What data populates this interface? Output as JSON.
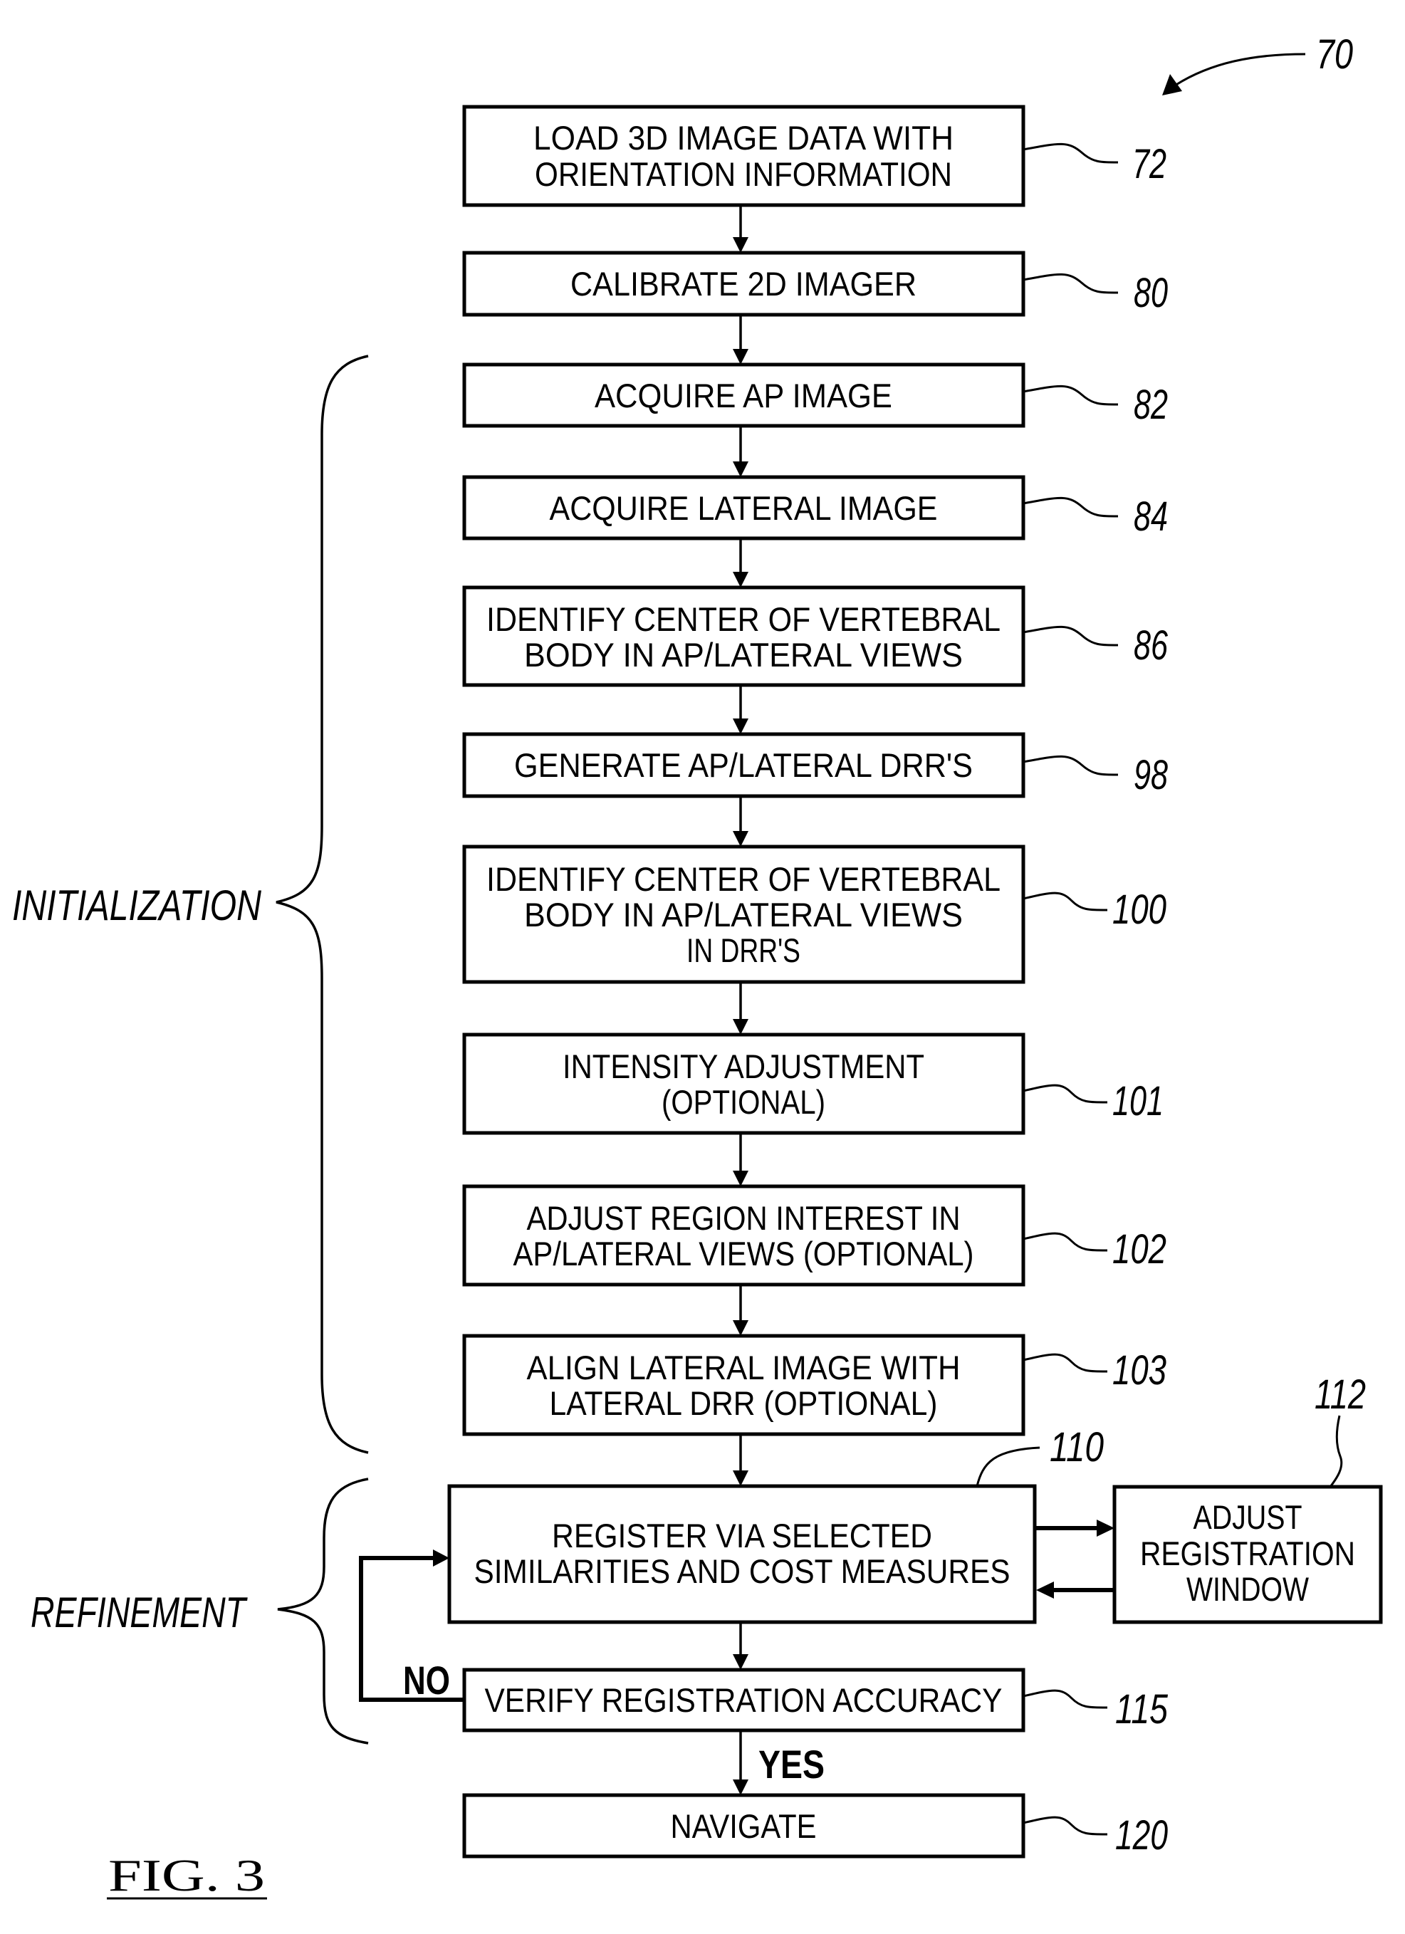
{
  "figure": {
    "label": "FIG.  3",
    "reference": "70"
  },
  "phases": {
    "initialization": "INITIALIZATION",
    "refinement": "REFINEMENT"
  },
  "decision": {
    "yes": "YES",
    "no": "NO"
  },
  "steps": {
    "load": {
      "ref": "72",
      "lines": [
        "LOAD  3D  IMAGE  DATA WITH",
        "ORIENTATION  INFORMATION"
      ]
    },
    "calibrate": {
      "ref": "80",
      "lines": [
        "CALIBRATE  2D  IMAGER"
      ]
    },
    "acquire_ap": {
      "ref": "82",
      "lines": [
        "ACQUIRE  AP  IMAGE"
      ]
    },
    "acquire_lateral": {
      "ref": "84",
      "lines": [
        "ACQUIRE  LATERAL  IMAGE"
      ]
    },
    "identify_center": {
      "ref": "86",
      "lines": [
        "IDENTIFY  CENTER  OF  VERTEBRAL",
        "BODY   IN  AP/LATERAL  VIEWS"
      ]
    },
    "generate_drr": {
      "ref": "98",
      "lines": [
        "GENERATE  AP/LATERAL  DRR'S"
      ]
    },
    "identify_center_drr": {
      "ref": "100",
      "lines": [
        "IDENTIFY  CENTER  OF  VERTEBRAL",
        "BODY   IN  AP/LATERAL  VIEWS",
        "IN  DRR'S"
      ]
    },
    "intensity": {
      "ref": "101",
      "lines": [
        "INTENSITY  ADJUSTMENT",
        "(OPTIONAL)"
      ]
    },
    "adjust_roi": {
      "ref": "102",
      "lines": [
        "ADJUST REGION  INTEREST IN",
        "AP/LATERAL VIEWS  (OPTIONAL)"
      ]
    },
    "align_lateral": {
      "ref": "103",
      "lines": [
        "ALIGN  LATERAL  IMAGE  WITH",
        "LATERAL  DRR  (OPTIONAL)"
      ]
    },
    "register": {
      "ref": "110",
      "lines": [
        "REGISTER  VIA  SELECTED",
        "SIMILARITIES  AND  COST MEASURES"
      ]
    },
    "adjust_window": {
      "ref": "112",
      "lines": [
        "ADJUST",
        "REGISTRATION",
        "WINDOW"
      ]
    },
    "verify": {
      "ref": "115",
      "lines": [
        "VERIFY  REGISTRATION  ACCURACY"
      ]
    },
    "navigate": {
      "ref": "120",
      "lines": [
        "NAVIGATE"
      ]
    }
  }
}
